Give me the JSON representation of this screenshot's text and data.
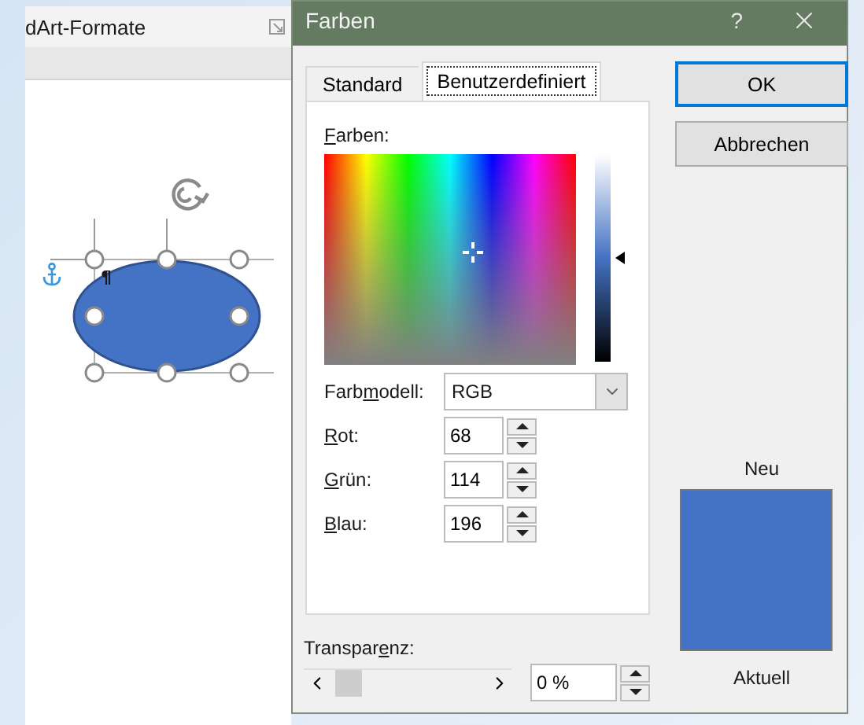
{
  "ribbon": {
    "group_label": "dArt-Formate"
  },
  "document": {
    "paragraph_mark": "¶"
  },
  "dialog": {
    "title": "Farben",
    "help": "?"
  },
  "tabs": [
    {
      "label": "Standard",
      "selected": false
    },
    {
      "label": "Benutzerdefiniert",
      "selected": true
    }
  ],
  "colors_label": {
    "key": "F",
    "after": "arben:"
  },
  "luminance": {
    "level": 0.5
  },
  "color_model": {
    "label": {
      "before": "Farb",
      "key": "m",
      "after": "odell:"
    },
    "value": "RGB"
  },
  "channels": [
    {
      "label": {
        "key": "R",
        "after": "ot:"
      },
      "value": "68"
    },
    {
      "label": {
        "key": "G",
        "after": "rün:"
      },
      "value": "114"
    },
    {
      "label": {
        "key": "B",
        "after": "lau:"
      },
      "value": "196"
    }
  ],
  "transparency": {
    "label": {
      "before": "Transpar",
      "key": "e",
      "after": "nz:"
    },
    "value": "0 %"
  },
  "buttons": [
    {
      "label": "OK",
      "default": true
    },
    {
      "label": "Abbrechen",
      "default": false
    }
  ],
  "preview": {
    "new_label": "Neu",
    "current_label": "Aktuell"
  }
}
